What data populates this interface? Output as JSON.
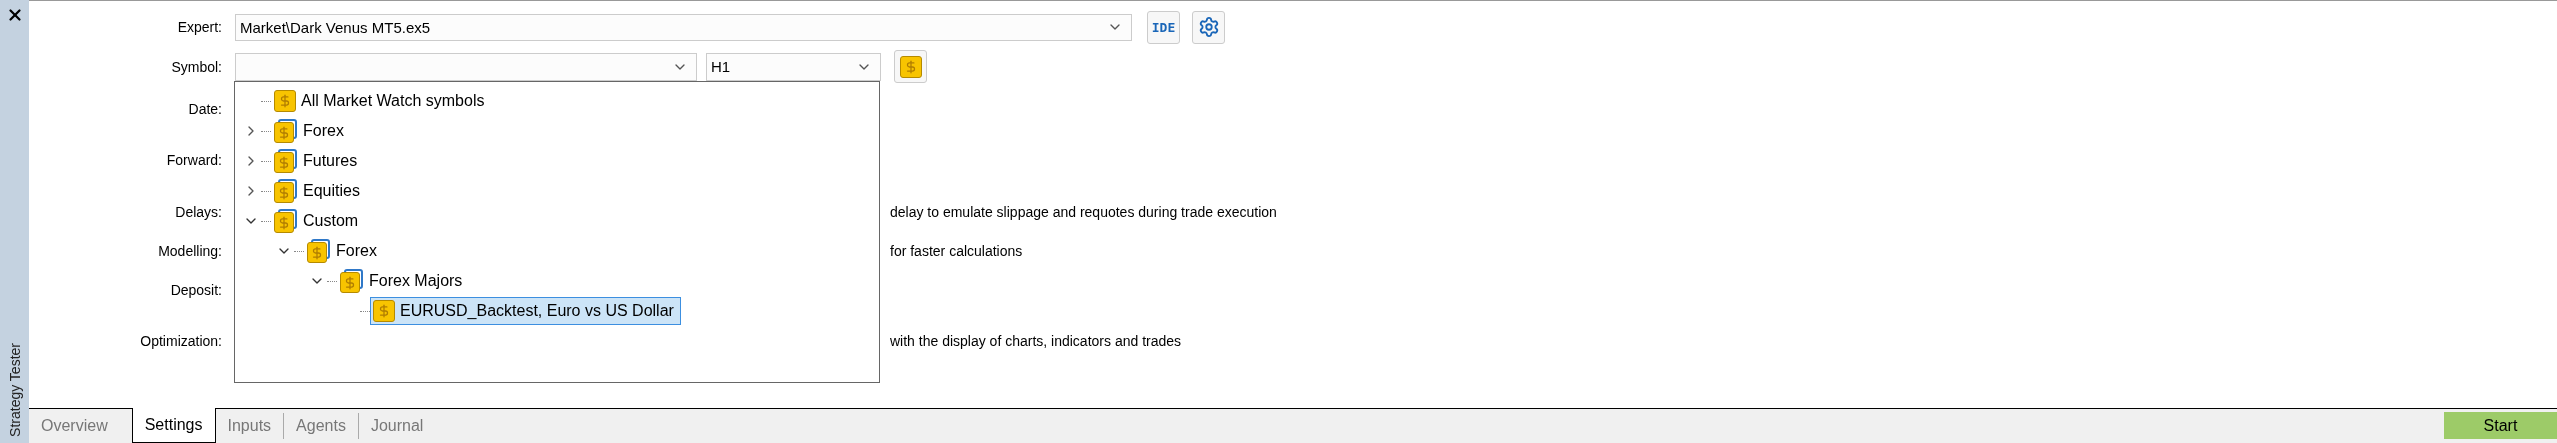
{
  "sidebar": {
    "title": "Strategy Tester"
  },
  "expert": {
    "label": "Expert:",
    "value": "Market\\Dark Venus MT5.ex5"
  },
  "ide_button": "IDE",
  "symbol": {
    "label": "Symbol:",
    "timeframe": "H1"
  },
  "symbol_dropdown": {
    "items": [
      {
        "kind": "symbol",
        "label": "All Market Watch symbols",
        "selected": false
      },
      {
        "kind": "group",
        "label": "Forex",
        "expanded": false,
        "selected": false
      },
      {
        "kind": "group",
        "label": "Futures",
        "expanded": false,
        "selected": false
      },
      {
        "kind": "group",
        "label": "Equities",
        "expanded": false,
        "selected": false
      },
      {
        "kind": "group",
        "label": "Custom",
        "expanded": true,
        "selected": false,
        "children": [
          {
            "kind": "group",
            "label": "Forex",
            "expanded": true,
            "selected": false,
            "children": [
              {
                "kind": "group",
                "label": "Forex Majors",
                "expanded": true,
                "selected": false,
                "children": [
                  {
                    "kind": "symbol",
                    "label": "EURUSD_Backtest, Euro vs US Dollar",
                    "selected": true
                  }
                ]
              }
            ]
          }
        ]
      }
    ]
  },
  "rows": [
    {
      "label": "Date:"
    },
    {
      "label": "Forward:"
    },
    {
      "label": "Delays:",
      "text": "delay to emulate slippage and requotes during trade execution"
    },
    {
      "label": "Modelling:",
      "text": "for faster calculations"
    },
    {
      "label": "Deposit:"
    },
    {
      "label": "Optimization:",
      "text": "with the display of charts, indicators and trades"
    }
  ],
  "tabs": [
    {
      "label": "Overview",
      "selected": false
    },
    {
      "label": "Settings",
      "selected": true
    },
    {
      "label": "Inputs",
      "selected": false
    },
    {
      "label": "Agents",
      "selected": false
    },
    {
      "label": "Journal",
      "selected": false
    }
  ],
  "start_button": "Start"
}
